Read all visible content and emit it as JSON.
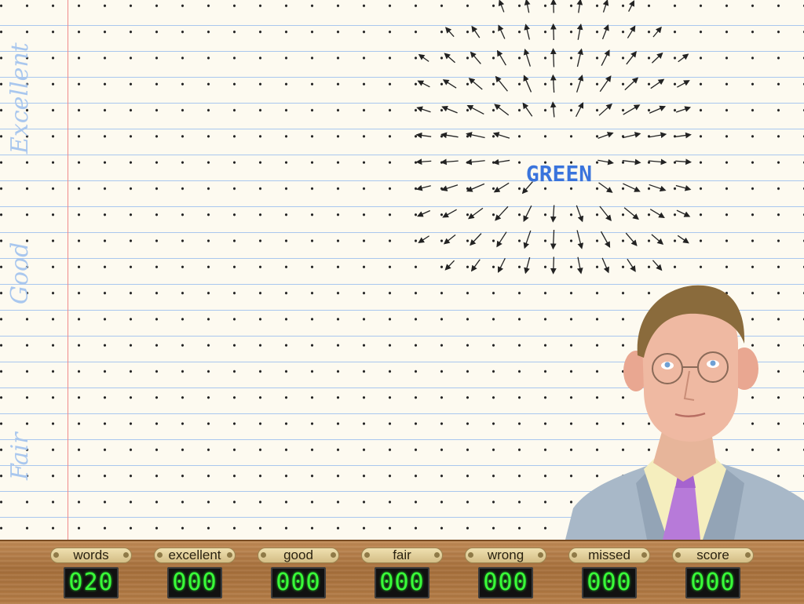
{
  "margin_labels": {
    "excellent": "Excellent",
    "good": "Good",
    "fair": "Fair"
  },
  "target_word": "GREEN",
  "counters": [
    {
      "label": "words",
      "value": "020"
    },
    {
      "label": "excellent",
      "value": "000"
    },
    {
      "label": "good",
      "value": "000"
    },
    {
      "label": "fair",
      "value": "000"
    },
    {
      "label": "wrong",
      "value": "000"
    },
    {
      "label": "missed",
      "value": "000"
    },
    {
      "label": "score",
      "value": "000"
    }
  ],
  "colors": {
    "word": "#3a74dc",
    "margin_line": "#f08a8a",
    "rule_line": "#a9c7ee",
    "led": "#39ff39"
  },
  "icons": {
    "field": "vector-field-arrows",
    "character": "man-portrait"
  }
}
